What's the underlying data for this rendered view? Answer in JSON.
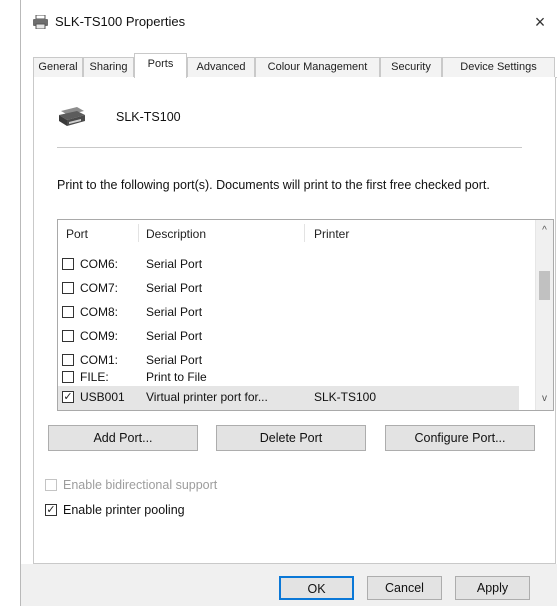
{
  "window": {
    "title": "SLK-TS100 Properties",
    "close_glyph": "×",
    "icon": "printer-icon"
  },
  "tabs": [
    {
      "label": "General",
      "active": false
    },
    {
      "label": "Sharing",
      "active": false
    },
    {
      "label": "Ports",
      "active": true
    },
    {
      "label": "Advanced",
      "active": false
    },
    {
      "label": "Colour Management",
      "active": false
    },
    {
      "label": "Security",
      "active": false
    },
    {
      "label": "Device Settings",
      "active": false
    }
  ],
  "ports_page": {
    "printer_name": "SLK-TS100",
    "intro_text": "Print to the following port(s). Documents will print to the first free checked port.",
    "columns": {
      "port": "Port",
      "description": "Description",
      "printer": "Printer"
    },
    "rows": [
      {
        "port": "COM6:",
        "description": "Serial Port",
        "printer": "",
        "checked": false,
        "selected": false
      },
      {
        "port": "COM7:",
        "description": "Serial Port",
        "printer": "",
        "checked": false,
        "selected": false
      },
      {
        "port": "COM8:",
        "description": "Serial Port",
        "printer": "",
        "checked": false,
        "selected": false
      },
      {
        "port": "COM9:",
        "description": "Serial Port",
        "printer": "",
        "checked": false,
        "selected": false
      },
      {
        "port": "COM1:",
        "description": "Serial Port",
        "printer": "",
        "checked": false,
        "selected": false
      },
      {
        "port": "FILE:",
        "description": "Print to File",
        "printer": "",
        "checked": false,
        "selected": false
      },
      {
        "port": "USB001",
        "description": "Virtual printer port for...",
        "printer": "SLK-TS100",
        "checked": true,
        "selected": true
      }
    ],
    "buttons": {
      "add_port": "Add Port...",
      "delete_port": "Delete Port",
      "configure_port": "Configure Port..."
    },
    "bidirectional": {
      "label": "Enable bidirectional support",
      "checked": false,
      "enabled": false
    },
    "pooling": {
      "label": "Enable printer pooling",
      "checked": true,
      "enabled": true
    }
  },
  "footer": {
    "ok": "OK",
    "cancel": "Cancel",
    "apply": "Apply"
  },
  "glyphs": {
    "check": "✓",
    "scroll_up": "^",
    "scroll_down": "v"
  },
  "colors": {
    "accent": "#0b78d7",
    "selected_row": "#e5e5e5",
    "footer": "#f0f0f0"
  }
}
